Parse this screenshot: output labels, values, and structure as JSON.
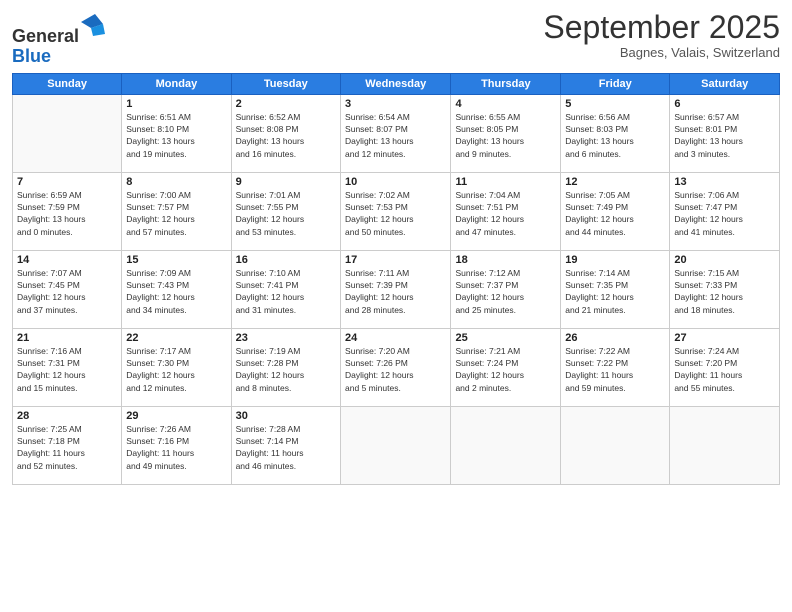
{
  "header": {
    "logo_line1": "General",
    "logo_line2": "Blue",
    "month_title": "September 2025",
    "location": "Bagnes, Valais, Switzerland"
  },
  "days_of_week": [
    "Sunday",
    "Monday",
    "Tuesday",
    "Wednesday",
    "Thursday",
    "Friday",
    "Saturday"
  ],
  "weeks": [
    [
      {
        "day": "",
        "info": ""
      },
      {
        "day": "1",
        "info": "Sunrise: 6:51 AM\nSunset: 8:10 PM\nDaylight: 13 hours\nand 19 minutes."
      },
      {
        "day": "2",
        "info": "Sunrise: 6:52 AM\nSunset: 8:08 PM\nDaylight: 13 hours\nand 16 minutes."
      },
      {
        "day": "3",
        "info": "Sunrise: 6:54 AM\nSunset: 8:07 PM\nDaylight: 13 hours\nand 12 minutes."
      },
      {
        "day": "4",
        "info": "Sunrise: 6:55 AM\nSunset: 8:05 PM\nDaylight: 13 hours\nand 9 minutes."
      },
      {
        "day": "5",
        "info": "Sunrise: 6:56 AM\nSunset: 8:03 PM\nDaylight: 13 hours\nand 6 minutes."
      },
      {
        "day": "6",
        "info": "Sunrise: 6:57 AM\nSunset: 8:01 PM\nDaylight: 13 hours\nand 3 minutes."
      }
    ],
    [
      {
        "day": "7",
        "info": "Sunrise: 6:59 AM\nSunset: 7:59 PM\nDaylight: 13 hours\nand 0 minutes."
      },
      {
        "day": "8",
        "info": "Sunrise: 7:00 AM\nSunset: 7:57 PM\nDaylight: 12 hours\nand 57 minutes."
      },
      {
        "day": "9",
        "info": "Sunrise: 7:01 AM\nSunset: 7:55 PM\nDaylight: 12 hours\nand 53 minutes."
      },
      {
        "day": "10",
        "info": "Sunrise: 7:02 AM\nSunset: 7:53 PM\nDaylight: 12 hours\nand 50 minutes."
      },
      {
        "day": "11",
        "info": "Sunrise: 7:04 AM\nSunset: 7:51 PM\nDaylight: 12 hours\nand 47 minutes."
      },
      {
        "day": "12",
        "info": "Sunrise: 7:05 AM\nSunset: 7:49 PM\nDaylight: 12 hours\nand 44 minutes."
      },
      {
        "day": "13",
        "info": "Sunrise: 7:06 AM\nSunset: 7:47 PM\nDaylight: 12 hours\nand 41 minutes."
      }
    ],
    [
      {
        "day": "14",
        "info": "Sunrise: 7:07 AM\nSunset: 7:45 PM\nDaylight: 12 hours\nand 37 minutes."
      },
      {
        "day": "15",
        "info": "Sunrise: 7:09 AM\nSunset: 7:43 PM\nDaylight: 12 hours\nand 34 minutes."
      },
      {
        "day": "16",
        "info": "Sunrise: 7:10 AM\nSunset: 7:41 PM\nDaylight: 12 hours\nand 31 minutes."
      },
      {
        "day": "17",
        "info": "Sunrise: 7:11 AM\nSunset: 7:39 PM\nDaylight: 12 hours\nand 28 minutes."
      },
      {
        "day": "18",
        "info": "Sunrise: 7:12 AM\nSunset: 7:37 PM\nDaylight: 12 hours\nand 25 minutes."
      },
      {
        "day": "19",
        "info": "Sunrise: 7:14 AM\nSunset: 7:35 PM\nDaylight: 12 hours\nand 21 minutes."
      },
      {
        "day": "20",
        "info": "Sunrise: 7:15 AM\nSunset: 7:33 PM\nDaylight: 12 hours\nand 18 minutes."
      }
    ],
    [
      {
        "day": "21",
        "info": "Sunrise: 7:16 AM\nSunset: 7:31 PM\nDaylight: 12 hours\nand 15 minutes."
      },
      {
        "day": "22",
        "info": "Sunrise: 7:17 AM\nSunset: 7:30 PM\nDaylight: 12 hours\nand 12 minutes."
      },
      {
        "day": "23",
        "info": "Sunrise: 7:19 AM\nSunset: 7:28 PM\nDaylight: 12 hours\nand 8 minutes."
      },
      {
        "day": "24",
        "info": "Sunrise: 7:20 AM\nSunset: 7:26 PM\nDaylight: 12 hours\nand 5 minutes."
      },
      {
        "day": "25",
        "info": "Sunrise: 7:21 AM\nSunset: 7:24 PM\nDaylight: 12 hours\nand 2 minutes."
      },
      {
        "day": "26",
        "info": "Sunrise: 7:22 AM\nSunset: 7:22 PM\nDaylight: 11 hours\nand 59 minutes."
      },
      {
        "day": "27",
        "info": "Sunrise: 7:24 AM\nSunset: 7:20 PM\nDaylight: 11 hours\nand 55 minutes."
      }
    ],
    [
      {
        "day": "28",
        "info": "Sunrise: 7:25 AM\nSunset: 7:18 PM\nDaylight: 11 hours\nand 52 minutes."
      },
      {
        "day": "29",
        "info": "Sunrise: 7:26 AM\nSunset: 7:16 PM\nDaylight: 11 hours\nand 49 minutes."
      },
      {
        "day": "30",
        "info": "Sunrise: 7:28 AM\nSunset: 7:14 PM\nDaylight: 11 hours\nand 46 minutes."
      },
      {
        "day": "",
        "info": ""
      },
      {
        "day": "",
        "info": ""
      },
      {
        "day": "",
        "info": ""
      },
      {
        "day": "",
        "info": ""
      }
    ]
  ]
}
